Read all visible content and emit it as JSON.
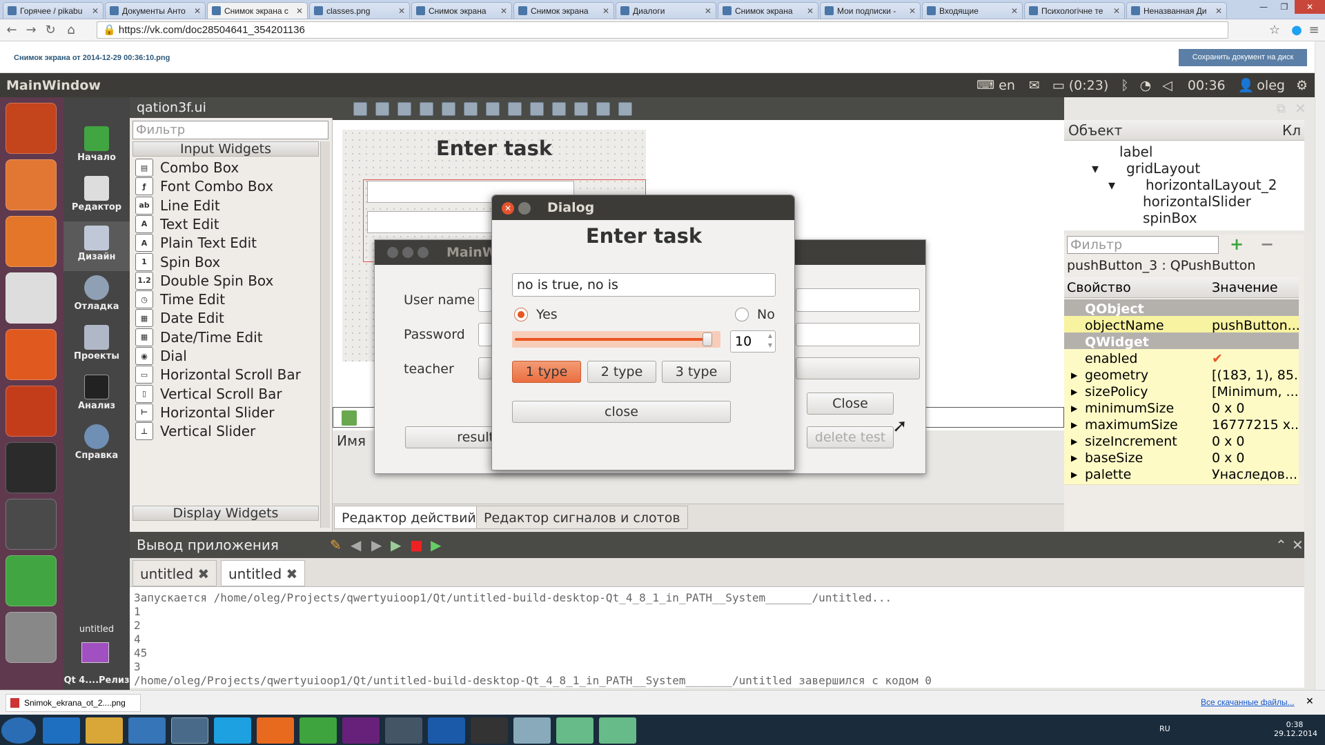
{
  "browser": {
    "tabs": [
      "Горячее / pikabu",
      "Документы Анто",
      "Снимок экрана с",
      "classes.png",
      "Снимок экрана",
      "Снимок экрана",
      "Диалоги",
      "Снимок экрана",
      "Мои подписки -",
      "Входящие",
      "Психологічне те",
      "Неназванная Ди"
    ],
    "url": "https://vk.com/doc28504641_354201136",
    "doc_title": "Снимок экрана от 2014-12-29 00:36:10.png",
    "save_btn": "Сохранить документ на диск",
    "download_file": "Snimok_ekrana_ot_2....png",
    "all_downloads": "Все скачанные файлы..."
  },
  "ubuntu": {
    "window_title": "MainWindow",
    "lang": "en",
    "battery": "(0:23)",
    "time": "00:36",
    "user": "oleg"
  },
  "modes": [
    "Начало",
    "Редактор",
    "Дизайн",
    "Отладка",
    "Проекты",
    "Анализ",
    "Справка"
  ],
  "build": {
    "project": "untitled",
    "kit": "Qt 4....Релиз"
  },
  "widget_box": {
    "file": "qation3f.ui",
    "filter": "Фильтр",
    "cat_input": "Input Widgets",
    "items": [
      "Combo Box",
      "Font Combo Box",
      "Line Edit",
      "Text Edit",
      "Plain Text Edit",
      "Spin Box",
      "Double Spin Box",
      "Time Edit",
      "Date Edit",
      "Date/Time Edit",
      "Dial",
      "Horizontal Scroll Bar",
      "Vertical Scroll Bar",
      "Horizontal Slider",
      "Vertical Slider"
    ],
    "cat_display": "Display Widgets"
  },
  "form": {
    "title": "Enter task"
  },
  "mainwindow": {
    "title": "MainW",
    "user_label": "User name",
    "pass_label": "Password",
    "teacher_label": "teacher",
    "close": "Close",
    "delete": "delete test",
    "result": "result",
    "col_name": "Имя"
  },
  "dialog": {
    "title": "Dialog",
    "heading": "Enter task",
    "text": "no is true, no is",
    "yes": "Yes",
    "no": "No",
    "spin": "10",
    "slider_value": 0.95,
    "type1": "1 type",
    "type2": "2 type",
    "type3": "3 type",
    "close": "close"
  },
  "object_inspector": {
    "col1": "Объект",
    "col2": "Кл",
    "rows": [
      "label",
      "gridLayout",
      "horizontalLayout_2",
      "horizontalSlider",
      "spinBox"
    ]
  },
  "property_editor": {
    "filter": "Фильтр",
    "selected": "pushButton_3 : QPushButton",
    "col1": "Свойство",
    "col2": "Значение",
    "rows": [
      {
        "k": "QObject",
        "v": "",
        "t": "sec"
      },
      {
        "k": "objectName",
        "v": "pushButton...",
        "t": "y2"
      },
      {
        "k": "QWidget",
        "v": "",
        "t": "sec"
      },
      {
        "k": "enabled",
        "v": "✔",
        "t": "y"
      },
      {
        "k": "geometry",
        "v": "[(183, 1), 85...",
        "t": "y"
      },
      {
        "k": "sizePolicy",
        "v": "[Minimum, ...",
        "t": "y"
      },
      {
        "k": "minimumSize",
        "v": "0 x 0",
        "t": "y"
      },
      {
        "k": "maximumSize",
        "v": "16777215 x...",
        "t": "y"
      },
      {
        "k": "sizeIncrement",
        "v": "0 x 0",
        "t": "y"
      },
      {
        "k": "baseSize",
        "v": "0 x 0",
        "t": "y"
      },
      {
        "k": "palette",
        "v": "Унаследов...",
        "t": "y"
      }
    ]
  },
  "action_tabs": [
    "Редактор действий",
    "Редактор сигналов и слотов"
  ],
  "output": {
    "title": "Вывод приложения",
    "tabs": [
      "untitled",
      "untitled"
    ],
    "lines": "Запускается /home/oleg/Projects/qwertyuioop1/Qt/untitled-build-desktop-Qt_4_8_1_in_PATH__System_______/untitled...\n1\n2\n4\n45\n3\n/home/oleg/Projects/qwertyuioop1/Qt/untitled-build-desktop-Qt_4_8_1_in_PATH__System_______/untitled завершился с кодом 0"
  },
  "taskbar": {
    "lang": "RU",
    "time": "0:38",
    "date": "29.12.2014"
  }
}
